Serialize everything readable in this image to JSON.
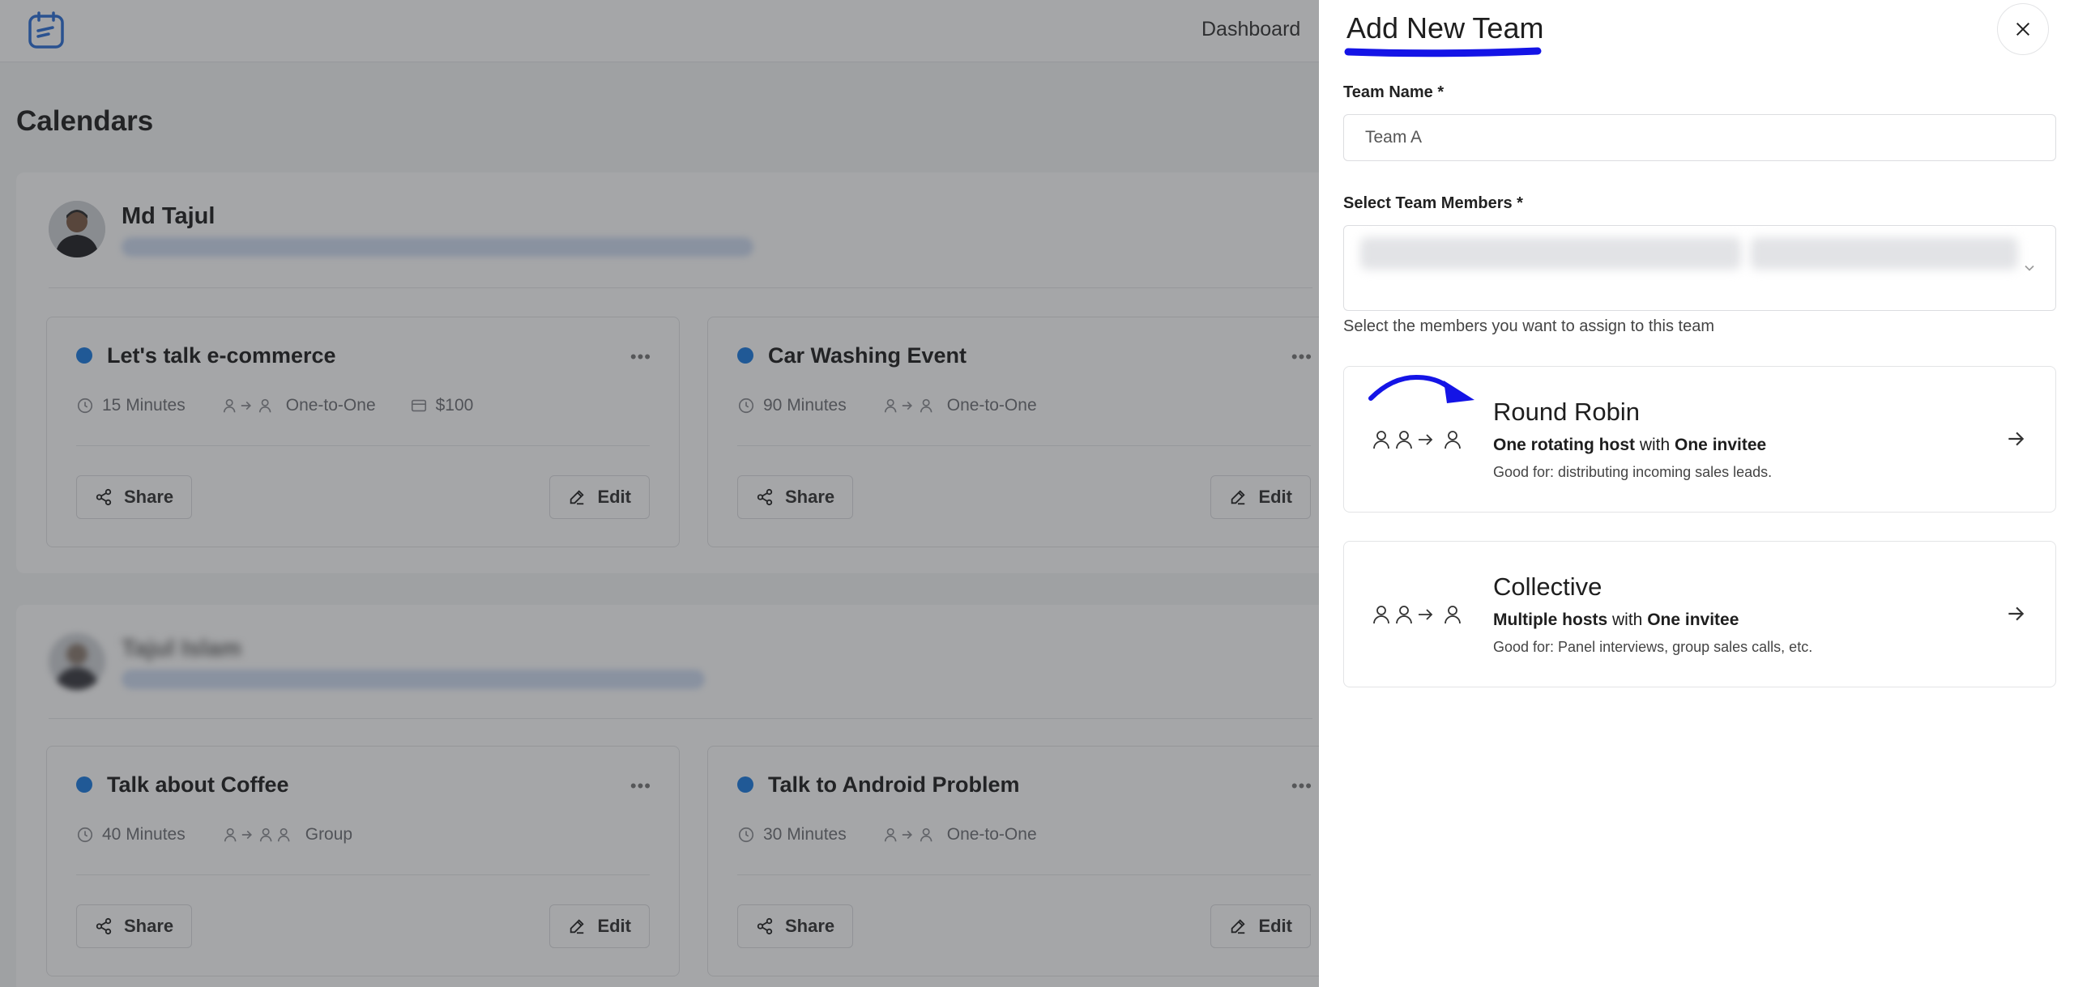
{
  "app": {
    "nav": {
      "dashboard": "Dashboard"
    },
    "page_title": "Calendars",
    "sections": [
      {
        "user_name": "Md Tajul",
        "events": [
          {
            "title": "Let's talk e-commerce",
            "duration": "15 Minutes",
            "type": "One-to-One",
            "price": "$100"
          },
          {
            "title": "Car Washing Event",
            "duration": "90 Minutes",
            "type": "One-to-One"
          }
        ]
      },
      {
        "user_name": "Tajul Islam",
        "events": [
          {
            "title": "Talk about Coffee",
            "duration": "40 Minutes",
            "type": "Group"
          },
          {
            "title": "Talk to Android Problem",
            "duration": "30 Minutes",
            "type": "One-to-One"
          }
        ]
      }
    ],
    "share_label": "Share",
    "edit_label": "Edit",
    "more_label": "•••"
  },
  "drawer": {
    "title": "Add New Team",
    "team_name_label": "Team Name *",
    "team_name_value": "Team A",
    "members_label": "Select Team Members *",
    "members_helper": "Select the members you want to assign to this team",
    "options": [
      {
        "title": "Round Robin",
        "desc_strong_1": "One rotating host",
        "desc_mid": " with ",
        "desc_strong_2": "One invitee",
        "good_for": "Good for: distributing incoming sales leads."
      },
      {
        "title": "Collective",
        "desc_strong_1": "Multiple hosts",
        "desc_mid": " with ",
        "desc_strong_2": "One invitee",
        "good_for": "Good for: Panel interviews, group sales calls, etc."
      }
    ]
  },
  "colors": {
    "accent": "#1a7ae0",
    "annotation": "#1414e6",
    "overlay": "#282a30"
  },
  "icons": [
    "logo-icon",
    "clock-icon",
    "user-icon",
    "arrow-right-icon",
    "price-tag-icon",
    "share-icon",
    "pencil-icon",
    "more-icon",
    "close-icon",
    "chevron-down-icon"
  ]
}
